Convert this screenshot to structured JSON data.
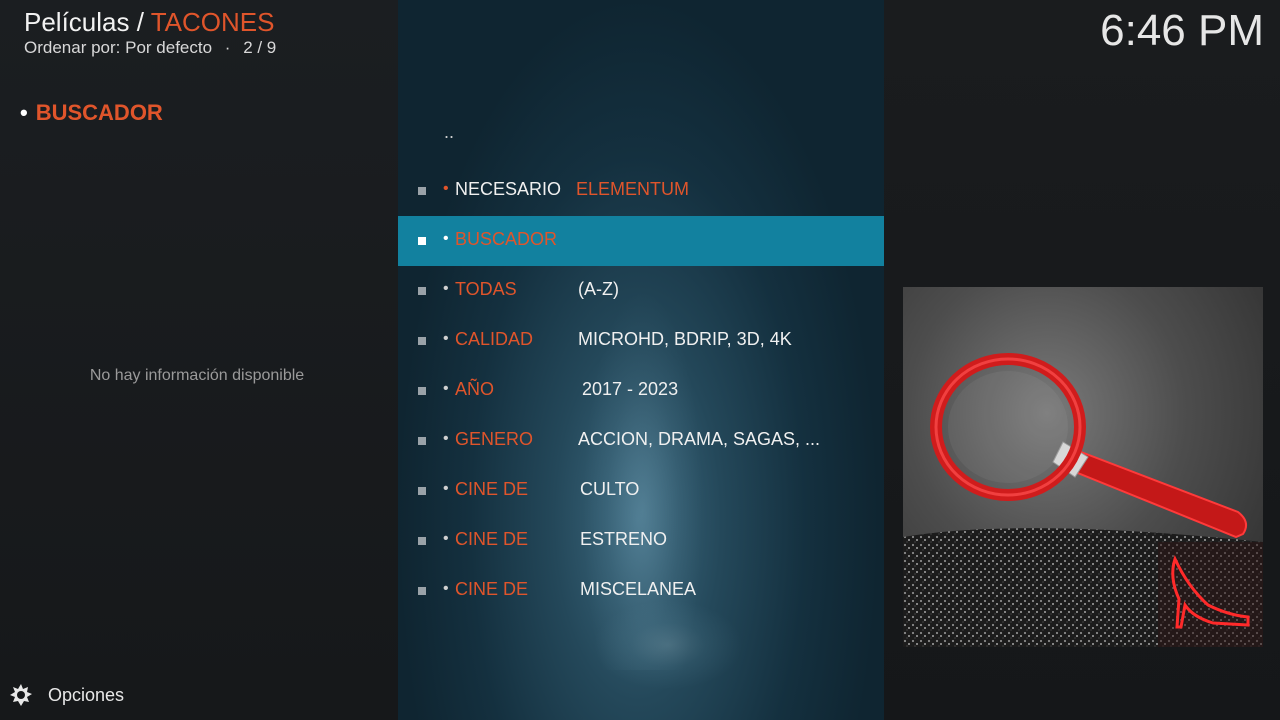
{
  "header": {
    "section": "Películas",
    "separator": " / ",
    "folder": "TACONES",
    "sort_label": "Ordenar por: Por defecto",
    "dot": "·",
    "position": "2 / 9"
  },
  "clock": "6:46 PM",
  "info": {
    "bullet": "•",
    "heading": "BUSCADOR",
    "no_info": "No hay información disponible"
  },
  "footer": {
    "options_label": "Opciones"
  },
  "list": {
    "parent_label": "..",
    "items": [
      {
        "bullet": "•",
        "label": "NECESARIO",
        "value": "ELEMENTUM"
      },
      {
        "bullet": "•",
        "label": "BUSCADOR",
        "value": ""
      },
      {
        "bullet": "•",
        "label": "TODAS",
        "value": "(A-Z)"
      },
      {
        "bullet": "•",
        "label": "CALIDAD",
        "value": "MICROHD, BDRIP, 3D, 4K"
      },
      {
        "bullet": "•",
        "label": "AÑO",
        "value": "2017 - 2023"
      },
      {
        "bullet": "•",
        "label": "GENERO",
        "value": "ACCION, DRAMA, SAGAS, ..."
      },
      {
        "bullet": "•",
        "label": "CINE DE",
        "value": "CULTO"
      },
      {
        "bullet": "•",
        "label": "CINE DE",
        "value": "ESTRENO"
      },
      {
        "bullet": "•",
        "label": "CINE DE",
        "value": "MISCELANEA"
      }
    ]
  },
  "colors": {
    "accent": "#e0552b",
    "focus": "#12819f",
    "background": "#151719"
  },
  "icons": {
    "options": "gear-icon",
    "thumbnail": "magnifier-red-heel-image"
  }
}
